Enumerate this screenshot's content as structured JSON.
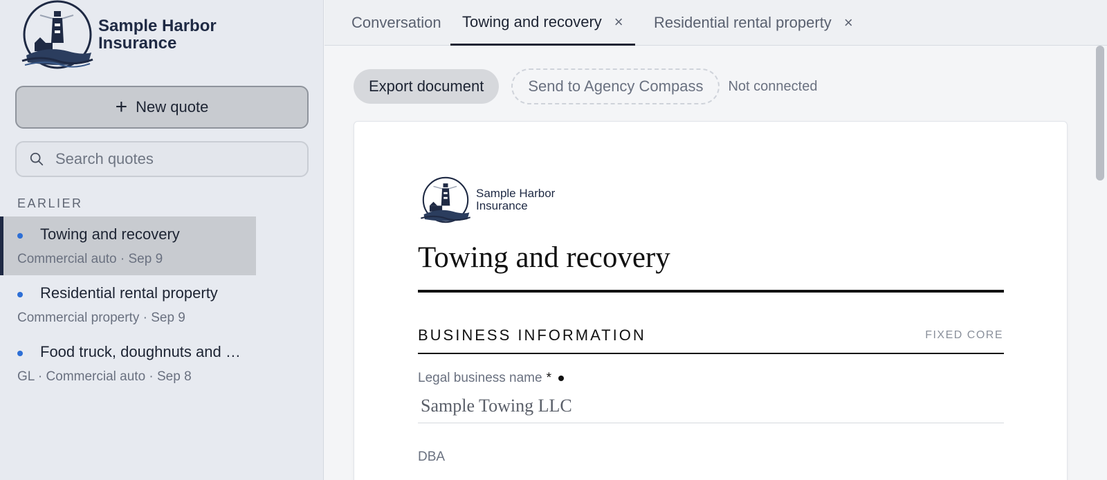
{
  "brand": {
    "name_line1": "Sample Harbor",
    "name_line2": "Insurance"
  },
  "sidebar": {
    "new_quote_label": "New quote",
    "search_placeholder": "Search quotes",
    "section_label": "EARLIER",
    "quotes": [
      {
        "title": "Towing and recovery",
        "meta": "Commercial auto · Sep 9",
        "active": true
      },
      {
        "title": "Residential rental property",
        "meta": "Commercial property · Sep 9",
        "active": false
      },
      {
        "title": "Food truck, doughnuts and more",
        "meta": "GL · Commercial auto · Sep 8",
        "active": false
      }
    ]
  },
  "tabs": [
    {
      "label": "Conversation",
      "closable": false,
      "active": false
    },
    {
      "label": "Towing and recovery",
      "closable": true,
      "active": true
    },
    {
      "label": "Residential rental property",
      "closable": true,
      "active": false
    }
  ],
  "toolbar": {
    "export_label": "Export document",
    "send_label": "Send to Agency Compass",
    "status": "Not connected"
  },
  "document": {
    "brand_line1": "Sample Harbor",
    "brand_line2": "Insurance",
    "title": "Towing and recovery",
    "section": {
      "heading": "BUSINESS INFORMATION",
      "tag": "FIXED CORE"
    },
    "fields": [
      {
        "label": "Legal business name",
        "required": "*",
        "value": "Sample Towing LLC"
      },
      {
        "label": "DBA",
        "value": ""
      }
    ]
  },
  "colors": {
    "accent_dot": "#2d6fd6",
    "brand_navy": "#1f2a44"
  },
  "icons": {
    "new_quote": "plus-icon",
    "search": "search-icon",
    "tab_close": "close-icon",
    "brand": "lighthouse-logo-icon"
  }
}
